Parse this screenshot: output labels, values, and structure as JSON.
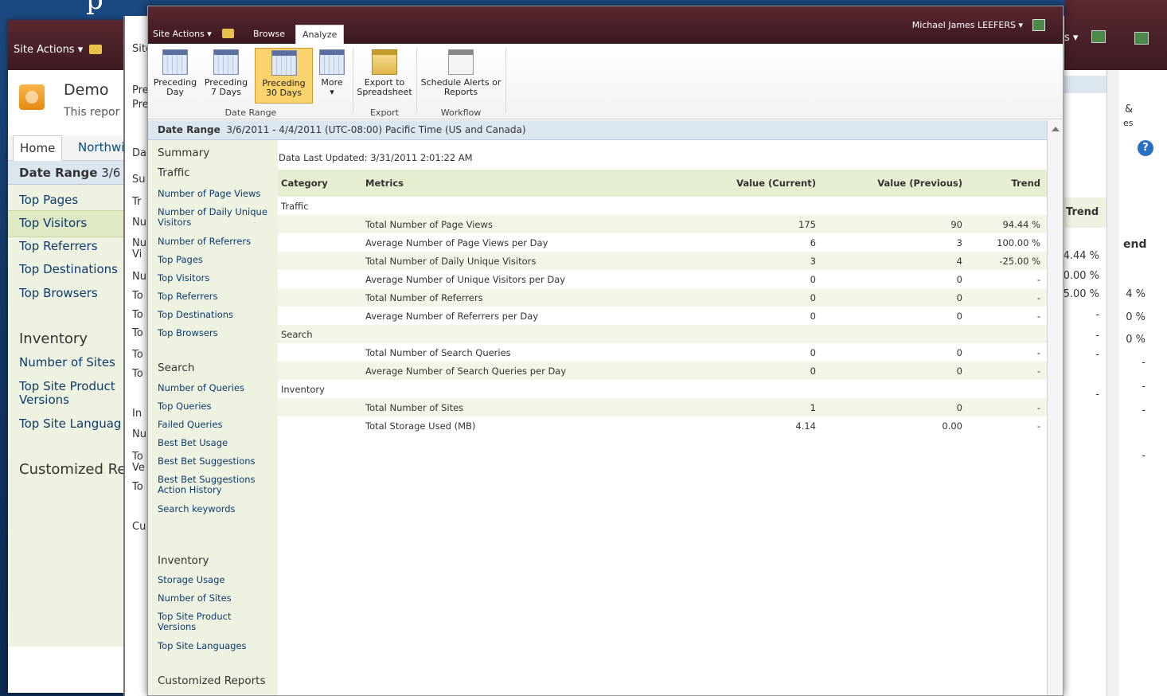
{
  "background": {
    "title_fragment": "p"
  },
  "back_window": {
    "site_actions": "Site Actions",
    "site_name": "Demo",
    "site_sub": "This repor",
    "nav_home": "Home",
    "nav_second": "Northwi",
    "date_range_label": "Date Range",
    "date_range_value": "3/6",
    "left_nav": [
      {
        "label": "Summary",
        "section": true
      },
      {
        "label": "Traffic",
        "section": true
      },
      {
        "label": "Number of Page V",
        "section": false
      },
      {
        "label": "Number of Daily",
        "section": false
      },
      {
        "label": "Visitors",
        "section": false
      },
      {
        "label": "Number of Referr",
        "section": false
      },
      {
        "label": "Top Pages",
        "section": false
      },
      {
        "label": "Top Visitors",
        "section": false
      },
      {
        "label": "Top Referrers",
        "section": false
      },
      {
        "label": "Top Destinations",
        "section": false
      },
      {
        "label": "Top Browsers",
        "section": false
      },
      {
        "label": "Inventory",
        "section": true
      },
      {
        "label": "Number of Sites",
        "section": false
      },
      {
        "label": "Top Site Product",
        "section": false
      },
      {
        "label": "Versions",
        "section": false
      },
      {
        "label": "Top Site Languag",
        "section": false
      },
      {
        "label": "Customized Rep",
        "section": true
      }
    ]
  },
  "mid_window": {
    "strip_texts": [
      "Site",
      "Pre",
      "Pre",
      "Da",
      "Su",
      "Tr",
      "Nu",
      "Nu",
      "Vi",
      "Nu",
      "To",
      "To",
      "To",
      "To",
      "To",
      "In",
      "Nu",
      "To",
      "Ve",
      "To",
      "Cu"
    ]
  },
  "right_strip": {
    "s_fragment": "s",
    "amp": "&",
    "es": "es",
    "trend_1": "Trend",
    "trend_2": "end",
    "vals_a": [
      "4.44 %",
      "0.00 %",
      "5.00 %",
      "-",
      "-",
      "-",
      "-"
    ],
    "vals_b": [
      "4 %",
      "0 %",
      "0 %",
      "-",
      "-",
      "-",
      "-"
    ]
  },
  "front": {
    "site_actions": "Site Actions",
    "tab_browse": "Browse",
    "tab_analyze": "Analyze",
    "user": "Michael James LEEFERS",
    "ribbon": {
      "preceding_day": "Preceding Day",
      "preceding_7": "Preceding 7 Days",
      "preceding_30": "Preceding 30 Days",
      "more": "More",
      "export": "Export to Spreadsheet",
      "schedule": "Schedule Alerts or Reports",
      "group_date": "Date Range",
      "group_export": "Export",
      "group_workflow": "Workflow"
    },
    "date_range_label": "Date Range",
    "date_range_value": "3/6/2011 - 4/4/2011 (UTC-08:00) Pacific Time (US and Canada)",
    "last_updated": "Data Last Updated: 3/31/2011 2:01:22 AM",
    "left_nav": {
      "summary": "Summary",
      "traffic": "Traffic",
      "page_views": "Number of Page Views",
      "daily_unique_1": "Number of Daily Unique",
      "daily_unique_2": "Visitors",
      "referrers": "Number of Referrers",
      "top_pages": "Top Pages",
      "top_visitors": "Top Visitors",
      "top_referrers": "Top Referrers",
      "top_destinations": "Top Destinations",
      "top_browsers": "Top Browsers",
      "search": "Search",
      "queries": "Number of Queries",
      "top_queries": "Top Queries",
      "failed_queries": "Failed Queries",
      "best_bet_usage": "Best Bet Usage",
      "best_bet_suggestions": "Best Bet Suggestions",
      "best_bet_history_1": "Best Bet Suggestions",
      "best_bet_history_2": "Action History",
      "search_keywords": "Search keywords",
      "inventory": "Inventory",
      "storage_usage": "Storage Usage",
      "number_of_sites": "Number of Sites",
      "top_product_1": "Top Site Product",
      "top_product_2": "Versions",
      "top_languages": "Top Site Languages",
      "customized": "Customized Reports"
    },
    "table": {
      "headers": {
        "category": "Category",
        "metrics": "Metrics",
        "current": "Value (Current)",
        "previous": "Value (Previous)",
        "trend": "Trend"
      },
      "rows": [
        {
          "category": "Traffic",
          "metric": "",
          "current": "",
          "previous": "",
          "trend": ""
        },
        {
          "category": "",
          "metric": "Total Number of Page Views",
          "current": "175",
          "previous": "90",
          "trend": "94.44 %"
        },
        {
          "category": "",
          "metric": "Average Number of Page Views per Day",
          "current": "6",
          "previous": "3",
          "trend": "100.00 %"
        },
        {
          "category": "",
          "metric": "Total Number of Daily Unique Visitors",
          "current": "3",
          "previous": "4",
          "trend": "-25.00 %"
        },
        {
          "category": "",
          "metric": "Average Number of Unique Visitors per Day",
          "current": "0",
          "previous": "0",
          "trend": "-"
        },
        {
          "category": "",
          "metric": "Total Number of Referrers",
          "current": "0",
          "previous": "0",
          "trend": "-"
        },
        {
          "category": "",
          "metric": "Average Number of Referrers per Day",
          "current": "0",
          "previous": "0",
          "trend": "-"
        },
        {
          "category": "Search",
          "metric": "",
          "current": "",
          "previous": "",
          "trend": ""
        },
        {
          "category": "",
          "metric": "Total Number of Search Queries",
          "current": "0",
          "previous": "0",
          "trend": "-"
        },
        {
          "category": "",
          "metric": "Average Number of Search Queries per Day",
          "current": "0",
          "previous": "0",
          "trend": "-"
        },
        {
          "category": "Inventory",
          "metric": "",
          "current": "",
          "previous": "",
          "trend": ""
        },
        {
          "category": "",
          "metric": "Total Number of Sites",
          "current": "1",
          "previous": "0",
          "trend": "-"
        },
        {
          "category": "",
          "metric": "Total Storage Used (MB)",
          "current": "4.14",
          "previous": "0.00",
          "trend": "-"
        }
      ]
    }
  }
}
